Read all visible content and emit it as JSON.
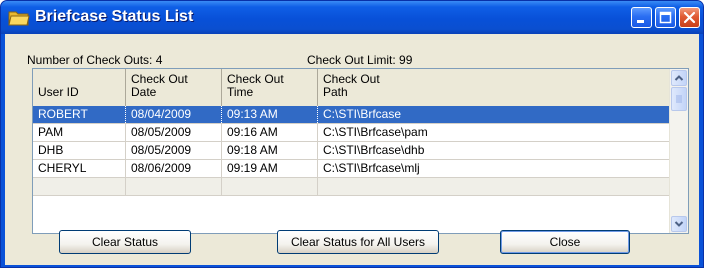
{
  "window": {
    "title": "Briefcase Status List",
    "controls": {
      "minimize": "minimize",
      "maximize": "maximize",
      "close": "close"
    }
  },
  "info": {
    "checkout_count_label": "Number of Check Outs:  4",
    "checkout_limit_label": "Check Out Limit:  99"
  },
  "grid": {
    "columns": [
      {
        "line1": "",
        "line2": "User ID"
      },
      {
        "line1": "Check Out",
        "line2": "Date"
      },
      {
        "line1": "Check Out",
        "line2": "Time"
      },
      {
        "line1": "Check Out",
        "line2": "Path"
      }
    ],
    "rows": [
      {
        "user": "ROBERT",
        "date": "08/04/2009",
        "time": "09:13 AM",
        "path": "C:\\STI\\Brfcase",
        "selected": true
      },
      {
        "user": "PAM",
        "date": "08/05/2009",
        "time": "09:16 AM",
        "path": "C:\\STI\\Brfcase\\pam",
        "selected": false
      },
      {
        "user": "DHB",
        "date": "08/05/2009",
        "time": "09:18 AM",
        "path": "C:\\STI\\Brfcase\\dhb",
        "selected": false
      },
      {
        "user": "CHERYL",
        "date": "08/06/2009",
        "time": "09:19 AM",
        "path": "C:\\STI\\Brfcase\\mlj",
        "selected": false
      }
    ]
  },
  "buttons": {
    "clear_status": "Clear Status",
    "clear_all": "Clear Status for All Users",
    "close": "Close"
  },
  "colors": {
    "titlebar": "#0a52d8",
    "selection": "#316ac5",
    "dialog_bg": "#ece9d8"
  }
}
